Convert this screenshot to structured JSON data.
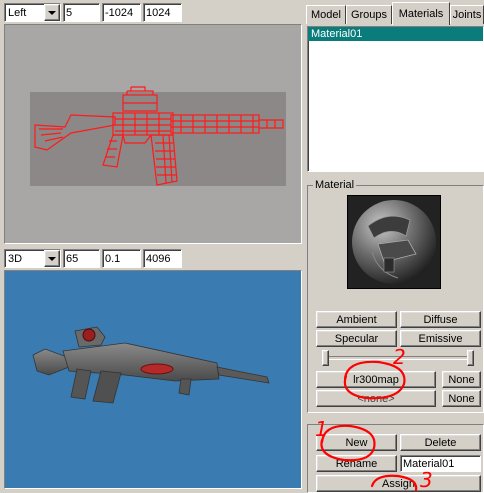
{
  "top_viewport": {
    "view_select": "Left",
    "field1": "5",
    "field2": "-1024",
    "field3": "1024"
  },
  "bottom_viewport": {
    "view_select": "3D",
    "field1": "65",
    "field2": "0.1",
    "field3": "4096"
  },
  "tabs": [
    {
      "label": "Model"
    },
    {
      "label": "Groups"
    },
    {
      "label": "Materials"
    },
    {
      "label": "Joints"
    }
  ],
  "materials_list": [
    "Material01"
  ],
  "material_panel": {
    "title": "Material",
    "ambient_label": "Ambient",
    "diffuse_label": "Diffuse",
    "specular_label": "Specular",
    "emissive_label": "Emissive",
    "texture_label": "lr300map",
    "texture_none_label": "None",
    "alpha_label": "<none>",
    "alpha_none_label": "None"
  },
  "bottom_panel": {
    "new_label": "New",
    "delete_label": "Delete",
    "rename_label": "Rename",
    "name_value": "Material01",
    "assign_label": "Assign"
  },
  "annotations": [
    {
      "number": "1"
    },
    {
      "number": "2"
    },
    {
      "number": "3"
    }
  ],
  "colors": {
    "wireframe": "#ff1a1a",
    "viewport_3d_bg": "#3a7cb1",
    "viewport_2d_bg": "#a9a6a6",
    "selection": "#0a7c7c",
    "annotation": "#ff0000"
  }
}
